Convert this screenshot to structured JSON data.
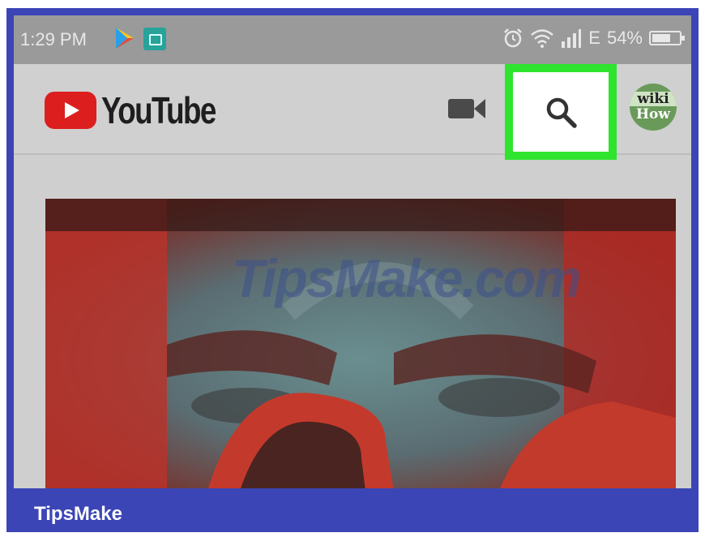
{
  "status_bar": {
    "time": "1:29 PM",
    "signal_label": "E",
    "battery": "54%",
    "icons": [
      "play-store-icon",
      "screenshot-icon",
      "alarm-icon",
      "wifi-icon",
      "signal-icon",
      "battery-icon"
    ]
  },
  "app_bar": {
    "brand": "YouTube",
    "avatar_line1": "wiki",
    "avatar_line2": "How",
    "icons": [
      "camera-icon",
      "search-icon"
    ],
    "highlight_color": "#2fe42f"
  },
  "video": {
    "watermark": "TipsMake.com"
  },
  "footer": {
    "label": "TipsMake"
  }
}
